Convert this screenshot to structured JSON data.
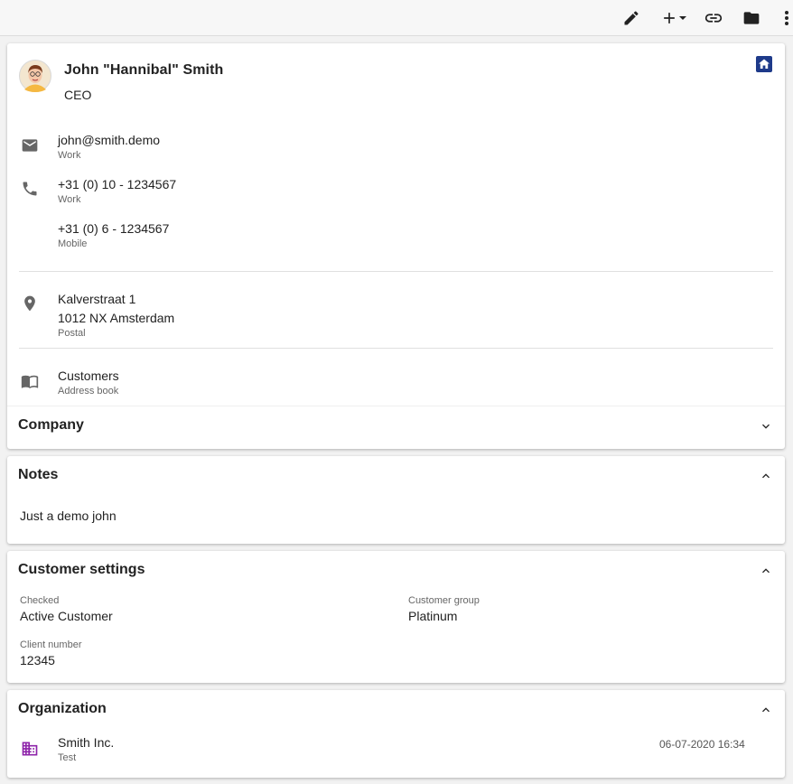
{
  "toolbar": {
    "edit_icon": "pencil-icon",
    "add_icon": "plus-dropdown-icon",
    "link_icon": "link-icon",
    "folder_icon": "folder-icon",
    "more_icon": "more-vertical-icon"
  },
  "contact": {
    "name": "John \"Hannibal\" Smith",
    "job_title": "CEO",
    "email": {
      "value": "john@smith.demo",
      "type": "Work"
    },
    "phones": [
      {
        "value": "+31 (0) 10 - 1234567",
        "type": "Work"
      },
      {
        "value": "+31 (0) 6 - 1234567",
        "type": "Mobile"
      }
    ],
    "address": {
      "street": "Kalverstraat 1",
      "city": "1012 NX Amsterdam",
      "type": "Postal"
    },
    "addressbook": {
      "value": "Customers",
      "label": "Address book"
    }
  },
  "company": {
    "title": "Company"
  },
  "notes": {
    "title": "Notes",
    "text": "Just a demo john"
  },
  "customer_settings": {
    "title": "Customer settings",
    "checked_label": "Checked",
    "checked_value": "Active Customer",
    "group_label": "Customer group",
    "group_value": "Platinum",
    "client_label": "Client number",
    "client_value": "12345"
  },
  "organization": {
    "title": "Organization",
    "items": [
      {
        "name": "Smith Inc.",
        "sub": "Test",
        "date": "06-07-2020 16:34"
      }
    ]
  },
  "colors": {
    "accent": "#1e3a8a",
    "org_icon": "#8e24aa",
    "icon_grey": "#666666"
  }
}
